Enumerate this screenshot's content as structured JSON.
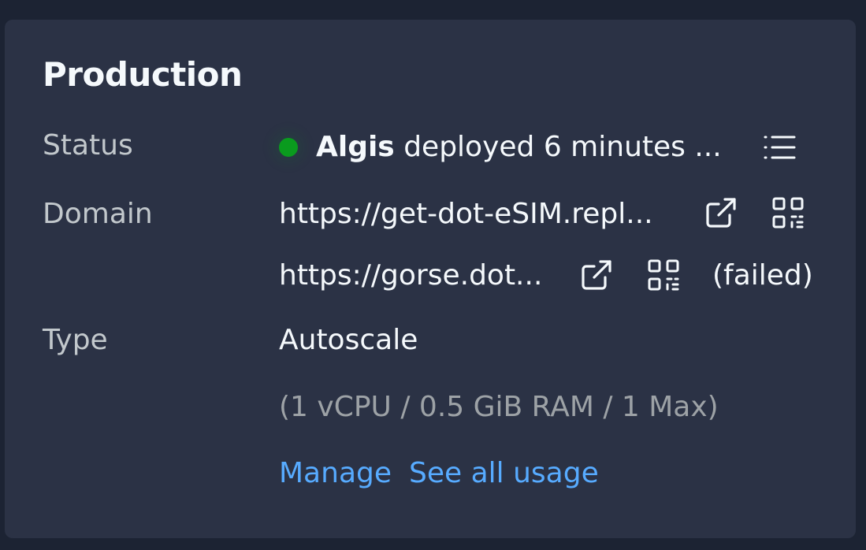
{
  "panel": {
    "title": "Production"
  },
  "status": {
    "label": "Status",
    "deployer": "Algis",
    "message": "deployed 6 minutes ...",
    "dot_color": "#0a9b1e"
  },
  "domain": {
    "label": "Domain",
    "items": [
      {
        "url": "https://get-dot-eSIM.repl...",
        "state": ""
      },
      {
        "url": "https://gorse.dot...",
        "state": "(failed)"
      }
    ]
  },
  "type": {
    "label": "Type",
    "value": "Autoscale",
    "spec": "(1 vCPU / 0.5 GiB RAM / 1 Max)",
    "manage_label": "Manage",
    "usage_label": "See all usage"
  },
  "colors": {
    "background": "#1c2333",
    "panel": "#2b3245",
    "link": "#57abff",
    "text": "#f5f9fc",
    "muted": "#9da2a6"
  },
  "icons": [
    "list-icon",
    "external-link-icon",
    "qr-code-icon"
  ]
}
